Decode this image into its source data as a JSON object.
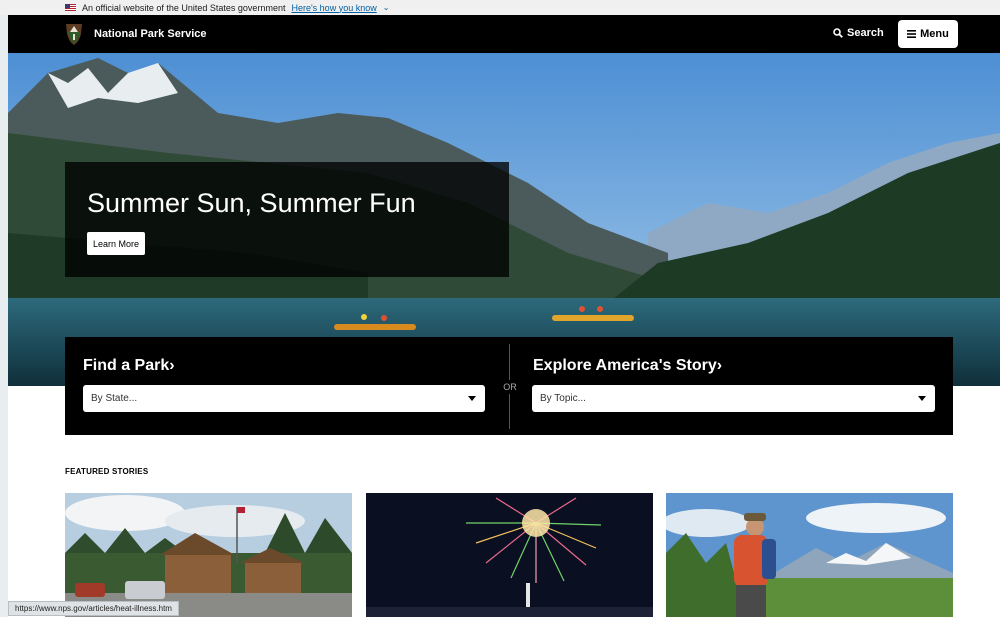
{
  "gov_banner": {
    "text": "An official website of the United States government",
    "link": "Here's how you know"
  },
  "header": {
    "brand": "National Park Service",
    "search_label": "Search",
    "menu_label": "Menu"
  },
  "hero": {
    "title": "Summer Sun, Summer Fun",
    "button_label": "Learn More"
  },
  "finder": {
    "find_park": {
      "title": "Find a Park",
      "select_value": "By State..."
    },
    "separator": "OR",
    "explore": {
      "title": "Explore America's Story",
      "select_value": "By Topic..."
    }
  },
  "featured": {
    "label": "FEATURED STORIES"
  },
  "status_bar": {
    "url": "https://www.nps.gov/articles/heat-illness.htm"
  },
  "colors": {
    "header_bg": "#000000",
    "link_blue": "#005ea2"
  }
}
